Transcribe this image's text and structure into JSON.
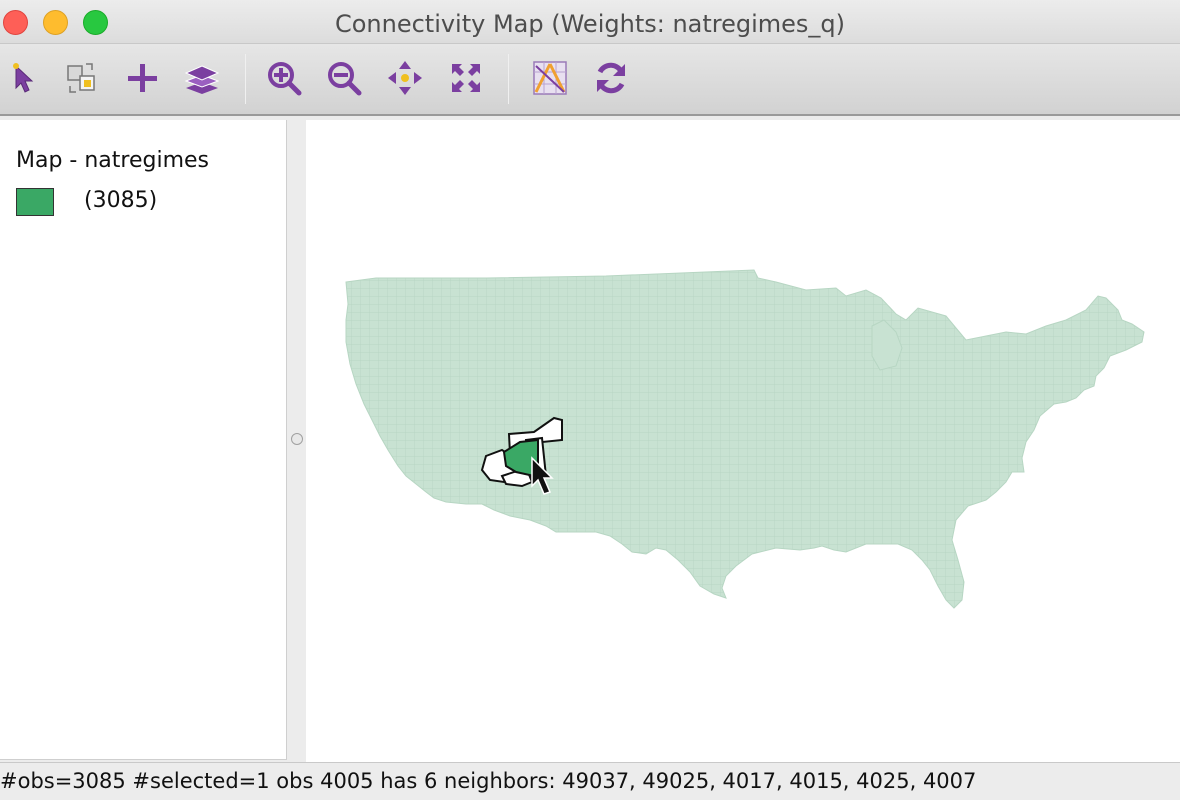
{
  "window": {
    "title": "Connectivity Map (Weights: natregimes_q)"
  },
  "toolbar": {
    "tools": [
      {
        "name": "select-tool",
        "icon": "pointer-arrow-icon"
      },
      {
        "name": "selection-mode-tool",
        "icon": "select-shapes-icon"
      },
      {
        "name": "add-layer-tool",
        "icon": "plus-icon"
      },
      {
        "name": "layers-tool",
        "icon": "layers-stack-icon"
      },
      {
        "name": "zoom-in-tool",
        "icon": "magnifier-plus-icon"
      },
      {
        "name": "zoom-out-tool",
        "icon": "magnifier-minus-icon"
      },
      {
        "name": "pan-tool",
        "icon": "move-arrows-icon"
      },
      {
        "name": "fit-extent-tool",
        "icon": "expand-arrows-icon"
      },
      {
        "name": "basemap-tool",
        "icon": "basemap-icon"
      },
      {
        "name": "refresh-tool",
        "icon": "refresh-icon"
      }
    ],
    "accent_color": "#7b3fa0"
  },
  "legend": {
    "title": "Map - natregimes",
    "items": [
      {
        "label": "(3085)",
        "color": "#3aa865"
      }
    ]
  },
  "map": {
    "fill_color": "#c8e2d2",
    "border_color": "#b7d6c3",
    "selected_color": "#3aa865",
    "neighbor_color": "#ffffff"
  },
  "status": {
    "text": "#obs=3085 #selected=1  obs 4005 has 6 neighbors: 49037, 49025, 4017, 4015, 4025, 4007"
  }
}
